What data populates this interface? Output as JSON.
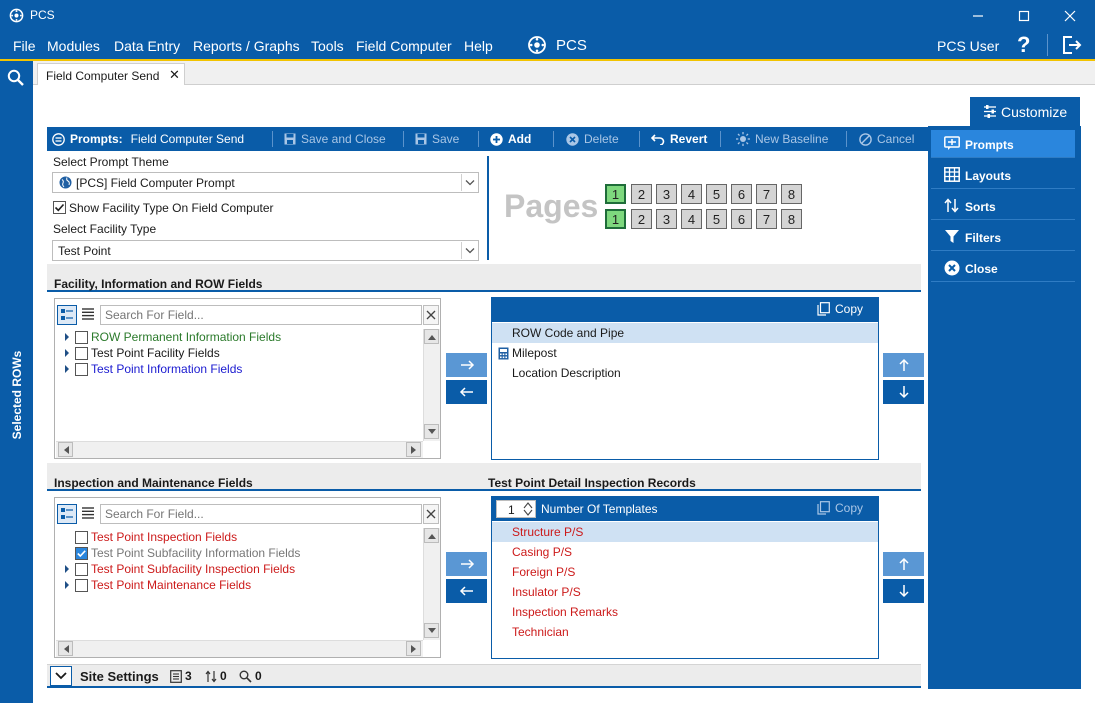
{
  "window": {
    "title": "PCS"
  },
  "menu": {
    "items": [
      "File",
      "Modules",
      "Data Entry",
      "Reports / Graphs",
      "Tools",
      "Field Computer",
      "Help"
    ],
    "brand": "PCS",
    "user": "PCS User"
  },
  "left_strip": {
    "label": "Selected ROWs"
  },
  "tab": {
    "label": "Field Computer Send"
  },
  "customize": {
    "label": "Customize"
  },
  "side_menu": [
    {
      "label": "Prompts",
      "icon": "prompts-icon"
    },
    {
      "label": "Layouts",
      "icon": "layouts-icon"
    },
    {
      "label": "Sorts",
      "icon": "sorts-icon"
    },
    {
      "label": "Filters",
      "icon": "filter-icon"
    },
    {
      "label": "Close",
      "icon": "close-circle-icon"
    }
  ],
  "toolbar": {
    "prompts_label": "Prompts:",
    "prompts_name": "Field Computer Send",
    "save_close": "Save and Close",
    "save": "Save",
    "add": "Add",
    "delete": "Delete",
    "revert": "Revert",
    "new_baseline": "New Baseline",
    "cancel": "Cancel"
  },
  "theme": {
    "label": "Select Prompt Theme",
    "value": "[PCS] Field Computer Prompt"
  },
  "show_facility": {
    "label": "Show Facility Type On Field Computer",
    "checked": true
  },
  "facility_type": {
    "label": "Select Facility Type",
    "value": "Test Point"
  },
  "pages": {
    "label": "Pages",
    "row1": [
      "1",
      "2",
      "3",
      "4",
      "5",
      "6",
      "7",
      "8"
    ],
    "row2": [
      "1",
      "2",
      "3",
      "4",
      "5",
      "6",
      "7",
      "8"
    ],
    "selected": "1"
  },
  "section1": {
    "title": "Facility, Information and ROW Fields",
    "search_placeholder": "Search For Field...",
    "tree": [
      {
        "label": "ROW Permanent Information Fields",
        "color": "#2b7a2b",
        "checked": false,
        "expandable": true
      },
      {
        "label": "Test Point Facility Fields",
        "color": "#1a1a1a",
        "checked": false,
        "expandable": true
      },
      {
        "label": "Test Point Information Fields",
        "color": "#1a1ad0",
        "checked": false,
        "expandable": true
      }
    ],
    "copy_label": "Copy",
    "selected_fields": [
      "ROW Code and Pipe",
      "Milepost",
      "Location Description"
    ]
  },
  "section2": {
    "title": "Inspection and Maintenance Fields",
    "right_title": "Test Point Detail Inspection Records",
    "search_placeholder": "Search For Field...",
    "tree": [
      {
        "label": "Test Point Inspection Fields",
        "color": "#cc1a1a",
        "checked": false,
        "expandable": false
      },
      {
        "label": "Test Point Subfacility Information Fields",
        "color": "#777777",
        "checked": true,
        "expandable": false
      },
      {
        "label": "Test Point Subfacility Inspection Fields",
        "color": "#cc1a1a",
        "checked": false,
        "expandable": true
      },
      {
        "label": "Test Point Maintenance Fields",
        "color": "#cc1a1a",
        "checked": false,
        "expandable": true
      }
    ],
    "num_templates_value": "1",
    "num_templates_label": "Number Of Templates",
    "copy_label": "Copy",
    "records": [
      "Structure P/S",
      "Casing P/S",
      "Foreign P/S",
      "Insulator P/S",
      "Inspection Remarks",
      "Technician"
    ]
  },
  "status": {
    "label": "Site Settings",
    "count_records": "3",
    "count_sorts": "0",
    "count_filters": "0"
  }
}
